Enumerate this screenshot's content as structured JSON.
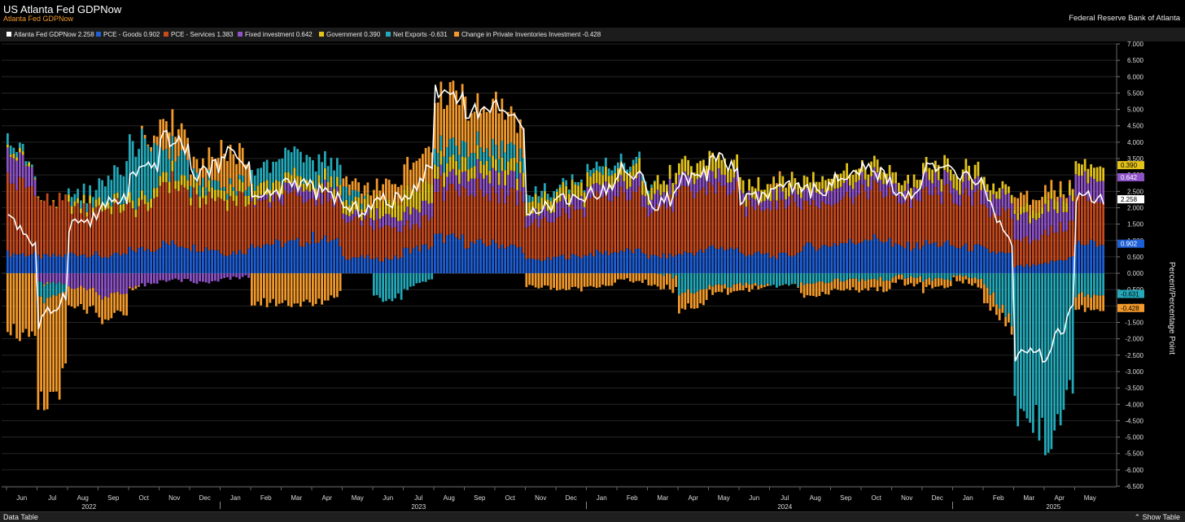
{
  "header": {
    "title": "US Atlanta Fed GDPNow",
    "subtitle": "Atlanta Fed GDPNow",
    "source": "Federal Reserve Bank of Atlanta"
  },
  "legend": [
    {
      "label": "Atlanta Fed GDPNow  2.258",
      "color": "#ffffff"
    },
    {
      "label": "PCE - Goods  0.902",
      "color": "#1f5fd6"
    },
    {
      "label": "PCE - Services  1.383",
      "color": "#c64a1e"
    },
    {
      "label": "Fixed investment  0.642",
      "color": "#8e52c7"
    },
    {
      "label": "Government  0.390",
      "color": "#e3c21a"
    },
    {
      "label": "Net Exports  -0.631",
      "color": "#23a9b9"
    },
    {
      "label": "Change in Private Inventories Investment  -0.428",
      "color": "#f39a2b"
    }
  ],
  "footer": {
    "data_table": "Data Table",
    "show_table": "Show Table"
  },
  "chart_data": {
    "type": "bar",
    "stacked": true,
    "overlay_line": "Atlanta Fed GDPNow",
    "ylabel": "Percent/Percentage Point",
    "ylim": [
      -6.5,
      7.0
    ],
    "ytick_step": 0.5,
    "ytick_labels": [
      "7.000",
      "6.500",
      "6.000",
      "5.500",
      "5.000",
      "4.500",
      "4.000",
      "3.500",
      "3.000",
      "2.500",
      "2.000",
      "1.500",
      "1.000",
      "0.500",
      "0.000",
      "-0.500",
      "-1.000",
      "-1.500",
      "-2.000",
      "-2.500",
      "-3.000",
      "-3.500",
      "-4.000",
      "-4.500",
      "-5.000",
      "-5.500",
      "-6.000",
      "-6.500"
    ],
    "grid": true,
    "legend_position": "top",
    "month_ticks": [
      "Jun",
      "Jul",
      "Aug",
      "Sep",
      "Oct",
      "Nov",
      "Dec",
      "Jan",
      "Feb",
      "Mar",
      "Apr",
      "May",
      "Jun",
      "Jul",
      "Aug",
      "Sep",
      "Oct",
      "Nov",
      "Dec",
      "Jan",
      "Feb",
      "Mar",
      "Apr",
      "May",
      "Jun",
      "Jul",
      "Aug",
      "Sep",
      "Oct",
      "Nov",
      "Dec",
      "Jan",
      "Feb",
      "Mar",
      "Apr",
      "May"
    ],
    "year_labels": [
      {
        "label": "2022",
        "after_month": "Aug"
      },
      {
        "label": "2023",
        "after_month": "Jun"
      },
      {
        "label": "2024",
        "after_month": "Jun"
      },
      {
        "label": "2025",
        "after_month": "Mar"
      }
    ],
    "series_names": [
      "PCE - Goods",
      "PCE - Services",
      "Fixed investment",
      "Government",
      "Net Exports",
      "Change in Private Inventories Investment",
      "Atlanta Fed GDPNow"
    ],
    "series_colors": [
      "#1f5fd6",
      "#c64a1e",
      "#8e52c7",
      "#e3c21a",
      "#23a9b9",
      "#f39a2b",
      "#ffffff"
    ],
    "periods": [
      {
        "month": "Jun 2022",
        "gdp": 1.9,
        "goods": 0.6,
        "services": 2.2,
        "fixed": 0.9,
        "gov": 0.1,
        "netx": 0.3,
        "inv": -1.6
      },
      {
        "month": "Jul 2022",
        "gdp": -1.6,
        "goods": 0.5,
        "services": 1.7,
        "fixed": -0.3,
        "gov": 0.0,
        "netx": -0.5,
        "inv": -3.5
      },
      {
        "month": "Aug 2022",
        "gdp": 1.5,
        "goods": 0.6,
        "services": 1.4,
        "fixed": -0.4,
        "gov": 0.2,
        "netx": 0.2,
        "inv": -0.6
      },
      {
        "month": "Sep 2022",
        "gdp": 2.0,
        "goods": 0.5,
        "services": 1.5,
        "fixed": -0.7,
        "gov": 0.2,
        "netx": 0.6,
        "inv": -0.8
      },
      {
        "month": "Oct 2022",
        "gdp": 2.9,
        "goods": 0.7,
        "services": 1.2,
        "fixed": -0.4,
        "gov": 0.3,
        "netx": 1.8,
        "inv": -0.1
      },
      {
        "month": "Nov 2022",
        "gdp": 4.2,
        "goods": 0.9,
        "services": 1.9,
        "fixed": -0.2,
        "gov": 0.3,
        "netx": 0.8,
        "inv": 0.9
      },
      {
        "month": "Dec 2022",
        "gdp": 3.0,
        "goods": 0.8,
        "services": 1.5,
        "fixed": -0.3,
        "gov": 0.3,
        "netx": 0.3,
        "inv": 0.4
      },
      {
        "month": "Jan 2023",
        "gdp": 3.8,
        "goods": 0.6,
        "services": 1.7,
        "fixed": -0.2,
        "gov": 0.3,
        "netx": 0.1,
        "inv": 1.3
      },
      {
        "month": "Feb 2023",
        "gdp": 2.3,
        "goods": 0.9,
        "services": 1.3,
        "fixed": 0.1,
        "gov": 0.4,
        "netx": 0.5,
        "inv": -0.9
      },
      {
        "month": "Mar 2023",
        "gdp": 2.8,
        "goods": 0.9,
        "services": 1.4,
        "fixed": 0.3,
        "gov": 0.3,
        "netx": 0.8,
        "inv": -0.9
      },
      {
        "month": "Apr 2023",
        "gdp": 2.5,
        "goods": 1.1,
        "services": 1.2,
        "fixed": 0.3,
        "gov": 0.3,
        "netx": 0.6,
        "inv": -1.0
      },
      {
        "month": "May 2023",
        "gdp": 1.9,
        "goods": 0.5,
        "services": 1.1,
        "fixed": 0.2,
        "gov": 0.4,
        "netx": 0.4,
        "inv": 0.3
      },
      {
        "month": "Jun 2023",
        "gdp": 2.2,
        "goods": 0.4,
        "services": 1.0,
        "fixed": 0.3,
        "gov": 0.4,
        "netx": -0.8,
        "inv": 0.5
      },
      {
        "month": "Jul 2023",
        "gdp": 2.3,
        "goods": 0.7,
        "services": 0.7,
        "fixed": 0.5,
        "gov": 0.6,
        "netx": -0.5,
        "inv": 0.8
      },
      {
        "month": "Aug 2023",
        "gdp": 5.6,
        "goods": 1.1,
        "services": 1.5,
        "fixed": 0.4,
        "gov": 0.4,
        "netx": 0.5,
        "inv": 1.6
      },
      {
        "month": "Sep 2023",
        "gdp": 4.9,
        "goods": 0.9,
        "services": 1.6,
        "fixed": 0.5,
        "gov": 0.4,
        "netx": 0.4,
        "inv": 1.2
      },
      {
        "month": "Oct 2023",
        "gdp": 5.3,
        "goods": 0.9,
        "services": 1.6,
        "fixed": 0.6,
        "gov": 0.4,
        "netx": 0.5,
        "inv": 1.4
      },
      {
        "month": "Nov 2023",
        "gdp": 2.0,
        "goods": 0.4,
        "services": 1.1,
        "fixed": 0.3,
        "gov": 0.4,
        "netx": 0.2,
        "inv": -0.4
      },
      {
        "month": "Dec 2023",
        "gdp": 2.3,
        "goods": 0.5,
        "services": 1.3,
        "fixed": 0.4,
        "gov": 0.4,
        "netx": 0.1,
        "inv": -0.5
      },
      {
        "month": "Jan 2024",
        "gdp": 2.4,
        "goods": 0.6,
        "services": 1.6,
        "fixed": 0.3,
        "gov": 0.4,
        "netx": 0.2,
        "inv": -0.4
      },
      {
        "month": "Feb 2024",
        "gdp": 3.2,
        "goods": 0.7,
        "services": 1.7,
        "fixed": 0.4,
        "gov": 0.4,
        "netx": 0.2,
        "inv": -0.2
      },
      {
        "month": "Mar 2024",
        "gdp": 2.1,
        "goods": 0.5,
        "services": 1.5,
        "fixed": 0.4,
        "gov": 0.4,
        "netx": 0.1,
        "inv": -0.4
      },
      {
        "month": "Apr 2024",
        "gdp": 2.8,
        "goods": 0.6,
        "services": 1.8,
        "fixed": 0.4,
        "gov": 0.4,
        "netx": -0.6,
        "inv": -0.5
      },
      {
        "month": "May 2024",
        "gdp": 3.6,
        "goods": 0.8,
        "services": 1.9,
        "fixed": 0.4,
        "gov": 0.5,
        "netx": -0.4,
        "inv": -0.2
      },
      {
        "month": "Jun 2024",
        "gdp": 2.2,
        "goods": 0.6,
        "services": 1.4,
        "fixed": 0.3,
        "gov": 0.4,
        "netx": -0.3,
        "inv": -0.2
      },
      {
        "month": "Jul 2024",
        "gdp": 2.6,
        "goods": 0.5,
        "services": 1.7,
        "fixed": 0.3,
        "gov": 0.4,
        "netx": -0.4,
        "inv": 0.1
      },
      {
        "month": "Aug 2024",
        "gdp": 2.5,
        "goods": 0.8,
        "services": 1.3,
        "fixed": 0.4,
        "gov": 0.4,
        "netx": -0.3,
        "inv": -0.4
      },
      {
        "month": "Sep 2024",
        "gdp": 2.8,
        "goods": 0.9,
        "services": 1.4,
        "fixed": 0.4,
        "gov": 0.4,
        "netx": -0.2,
        "inv": -0.3
      },
      {
        "month": "Oct 2024",
        "gdp": 3.2,
        "goods": 1.1,
        "services": 1.5,
        "fixed": 0.4,
        "gov": 0.4,
        "netx": -0.2,
        "inv": -0.3
      },
      {
        "month": "Nov 2024",
        "gdp": 2.3,
        "goods": 0.8,
        "services": 1.4,
        "fixed": 0.3,
        "gov": 0.3,
        "netx": -0.1,
        "inv": -0.2
      },
      {
        "month": "Dec 2024",
        "gdp": 3.2,
        "goods": 0.9,
        "services": 1.5,
        "fixed": 0.4,
        "gov": 0.4,
        "netx": -0.2,
        "inv": -0.3
      },
      {
        "month": "Jan 2025",
        "gdp": 3.0,
        "goods": 0.8,
        "services": 1.5,
        "fixed": 0.4,
        "gov": 0.4,
        "netx": -0.1,
        "inv": -0.1
      },
      {
        "month": "Feb 2025",
        "gdp": 2.4,
        "goods": 0.7,
        "services": 1.3,
        "fixed": 0.5,
        "gov": 0.3,
        "netx": -0.3,
        "inv": -0.5
      },
      {
        "month": "Mar 2025",
        "gdp": -2.5,
        "goods": 0.2,
        "services": 0.8,
        "fixed": 0.7,
        "gov": 0.2,
        "netx": -4.2,
        "inv": 0.4
      },
      {
        "month": "Apr 2025",
        "gdp": -2.6,
        "goods": 0.3,
        "services": 0.9,
        "fixed": 0.7,
        "gov": 0.3,
        "netx": -5.0,
        "inv": 0.3
      },
      {
        "month": "May 2025",
        "gdp": 2.258,
        "goods": 0.902,
        "services": 1.383,
        "fixed": 0.642,
        "gov": 0.39,
        "netx": -0.631,
        "inv": -0.428
      }
    ],
    "last_value_tags": [
      {
        "value": "0.390",
        "color": "#e3c21a",
        "text_color": "#000000",
        "y": 3.3
      },
      {
        "value": "0.642",
        "color": "#8e52c7",
        "text_color": "#ffffff",
        "y": 2.93
      },
      {
        "value": "2.258",
        "color": "#ffffff",
        "text_color": "#000000",
        "y": 2.258
      },
      {
        "value": "0.902",
        "color": "#1f5fd6",
        "text_color": "#ffffff",
        "y": 0.902
      },
      {
        "value": "-0.631",
        "color": "#23a9b9",
        "text_color": "#000000",
        "y": -0.631
      },
      {
        "value": "-0.428",
        "color": "#f39a2b",
        "text_color": "#000000",
        "y": -1.06
      }
    ]
  }
}
